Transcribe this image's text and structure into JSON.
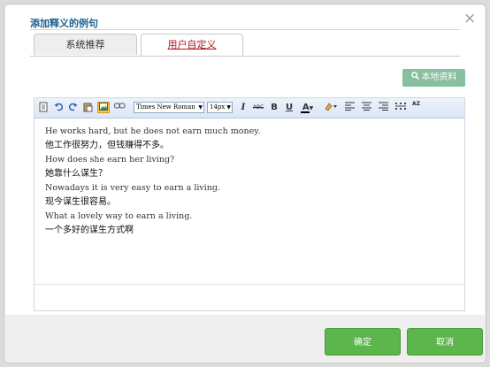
{
  "dialog": {
    "title": "添加释义的例句",
    "close_glyph": "×"
  },
  "tabs": [
    {
      "label": "系统推荐",
      "active": false
    },
    {
      "label": "用户自定义",
      "active": true
    }
  ],
  "local_button": {
    "label": "本地资料",
    "icon": "search-icon"
  },
  "toolbar": {
    "font_family": "Times New Roman",
    "font_size": "14px",
    "glyphs": {
      "italic": "I",
      "strike": "ABC",
      "bold": "B",
      "underline": "U",
      "font_color": "A",
      "sort": "AZ"
    }
  },
  "examples": [
    {
      "en": "He works hard, but he does not earn much money.",
      "zh": "他工作很努力，但钱赚得不多。"
    },
    {
      "en": "How does she earn her living?",
      "zh": "她靠什么谋生？"
    },
    {
      "en": "Nowadays it is very easy to earn a living.",
      "zh": "现今谋生很容易。"
    },
    {
      "en": "What a lovely way to earn a living.",
      "zh": "一个多好的谋生方式啊"
    }
  ],
  "footer": {
    "ok_label": "确定",
    "cancel_label": "取消"
  },
  "colors": {
    "title": "#1b5e8c",
    "active_tab_text": "#b8141b",
    "primary_button": "#5db54d",
    "local_button": "#88bf9e"
  }
}
